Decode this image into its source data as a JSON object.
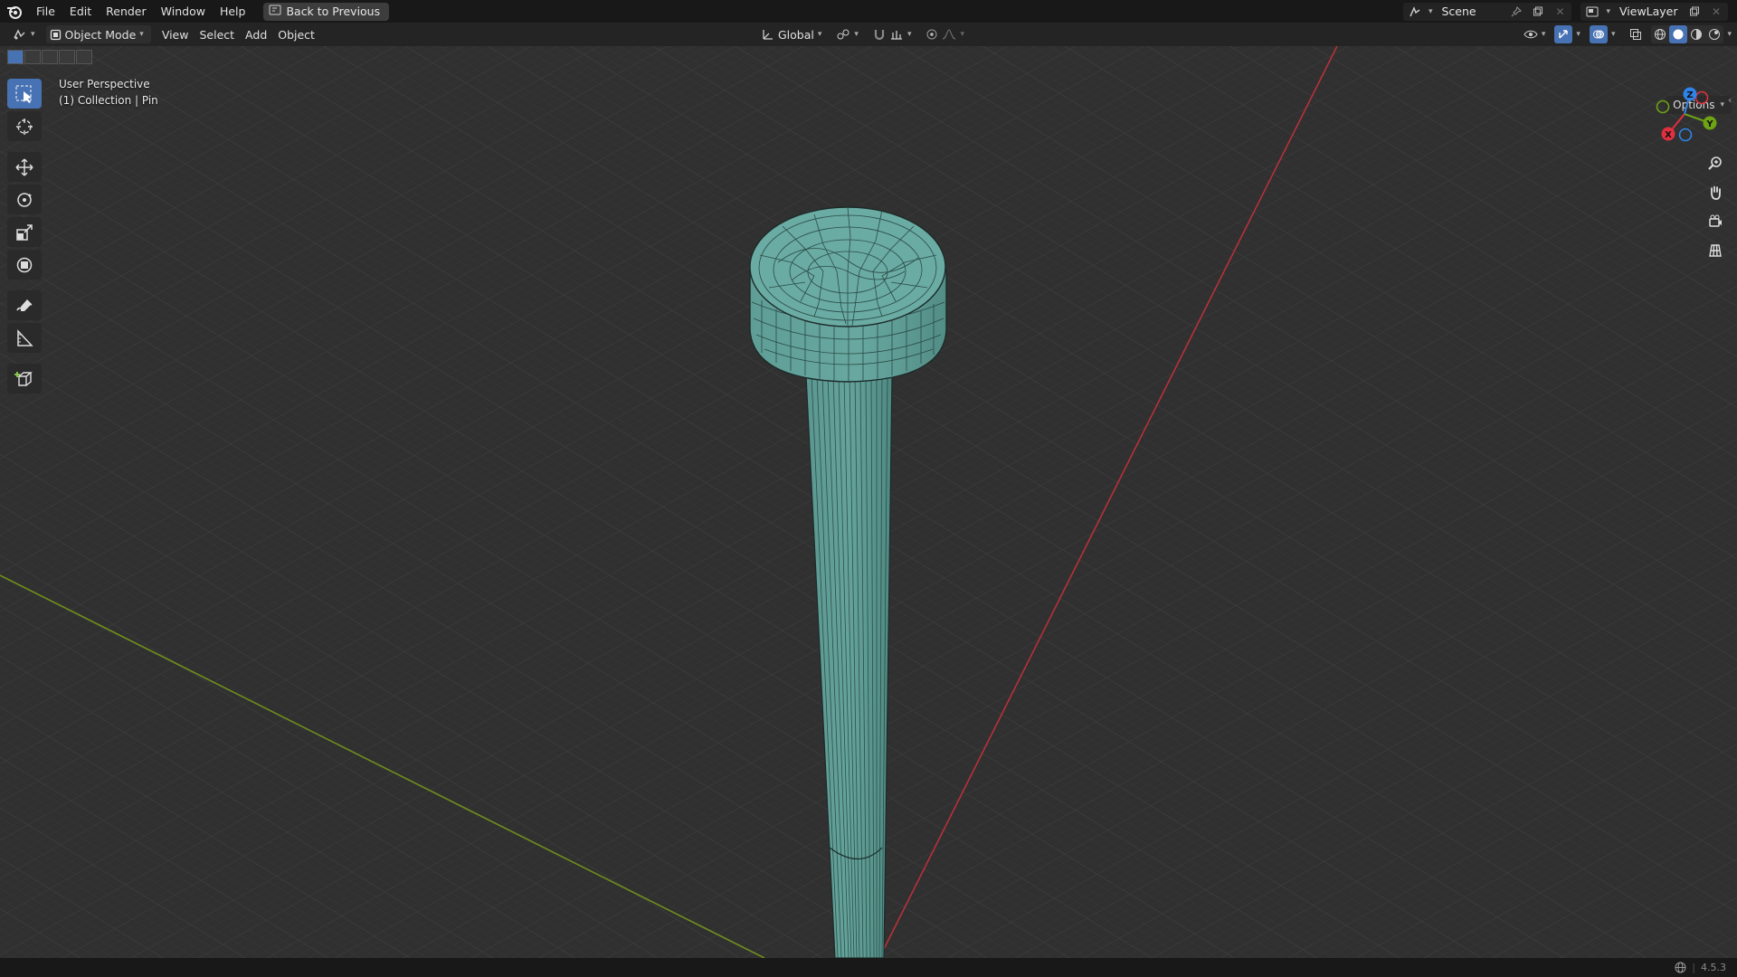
{
  "topbar": {
    "menus": [
      "File",
      "Edit",
      "Render",
      "Window",
      "Help"
    ],
    "back_label": "Back to Previous",
    "scene_name": "Scene",
    "view_layer": "ViewLayer"
  },
  "header": {
    "mode": "Object Mode",
    "menus": [
      "View",
      "Select",
      "Add",
      "Object"
    ],
    "orientation": "Global"
  },
  "viewport": {
    "view_name": "User Perspective",
    "collection_info": "(1) Collection | Pin",
    "options_label": "Options"
  },
  "gizmo": {
    "x": "X",
    "y": "Y",
    "z": "Z"
  },
  "statusbar": {
    "version": "4.5.3"
  },
  "colors": {
    "accent": "#4772b3",
    "x_axis": "#e0303f",
    "y_axis": "#6ea313",
    "z_axis": "#2f83e8",
    "object": "#5e9b93"
  },
  "icons": [
    "blender-logo-icon",
    "back-icon",
    "select-box-icon",
    "cursor-icon",
    "move-icon",
    "rotate-icon",
    "scale-icon",
    "transform-icon",
    "annotate-icon",
    "measure-icon",
    "add-cube-icon",
    "zoom-icon",
    "hand-icon",
    "camera-icon",
    "grid-icon"
  ]
}
